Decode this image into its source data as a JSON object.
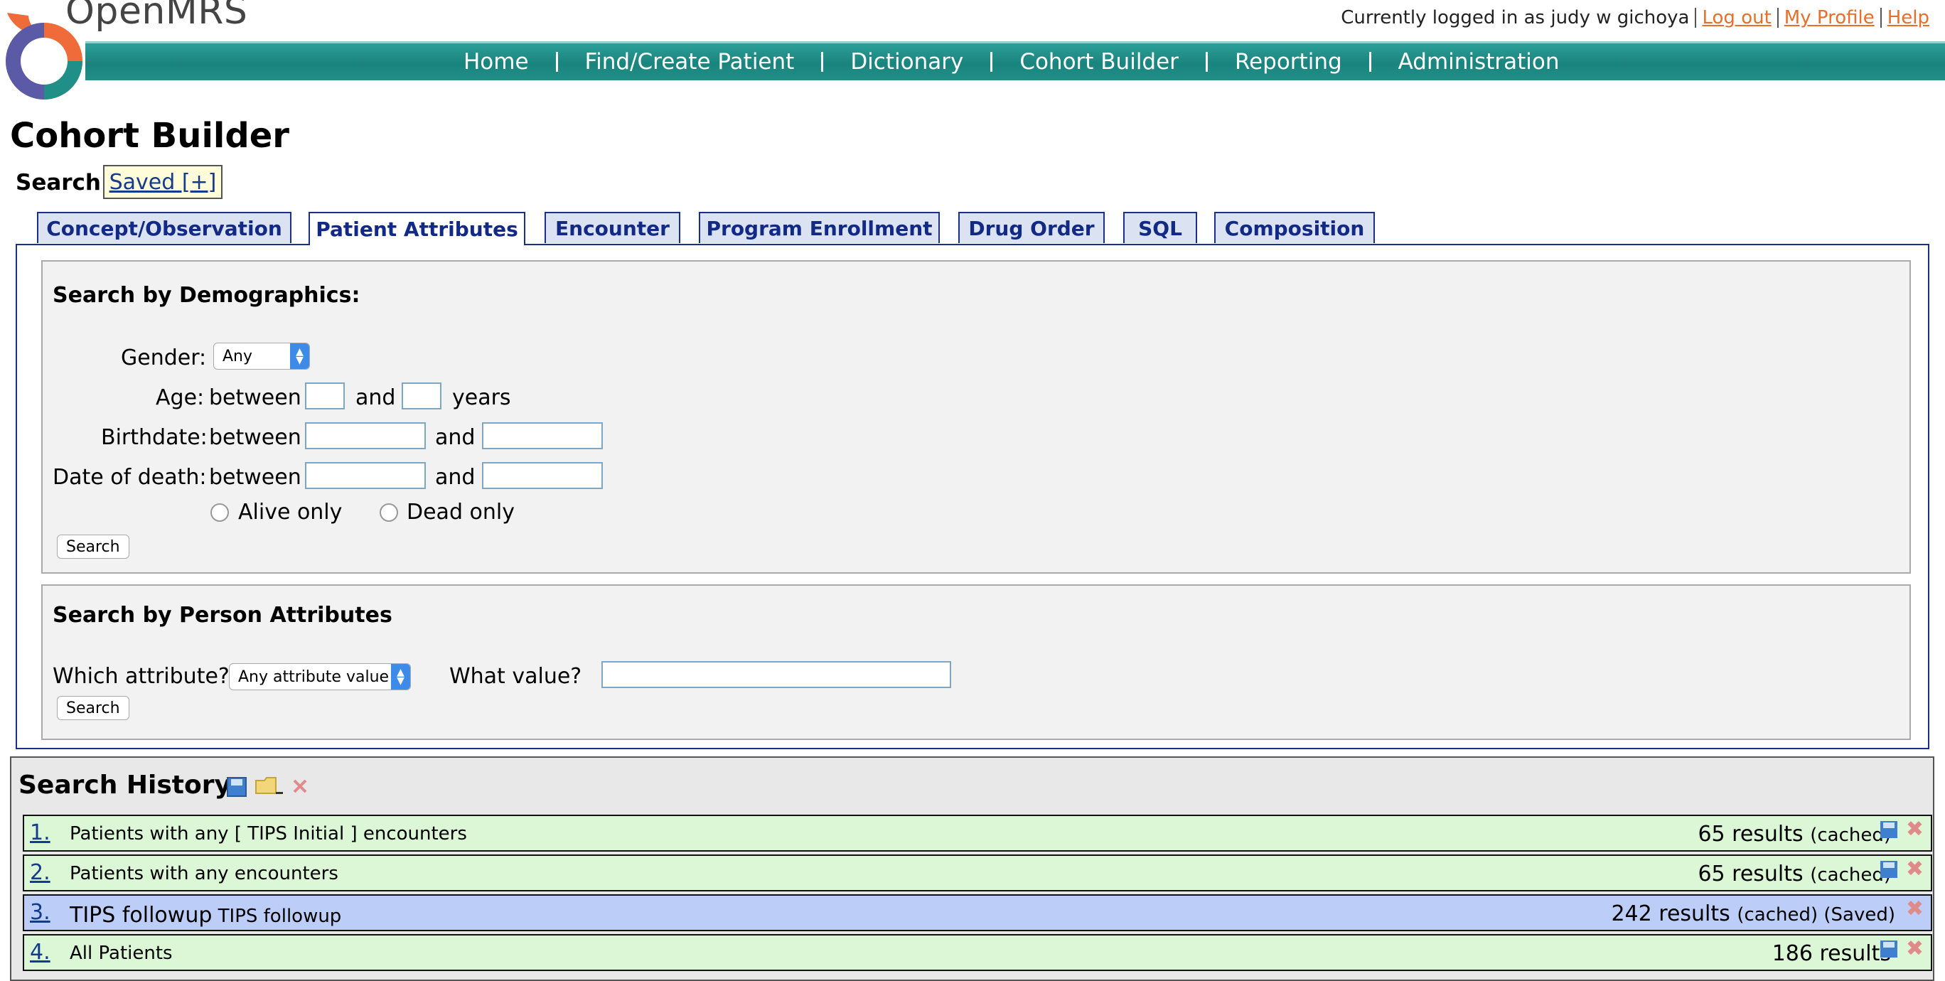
{
  "header": {
    "brand": "OpenMRS",
    "logged_in_text": "Currently logged in as judy w gichoya",
    "logout_label": "Log out",
    "profile_label": "My Profile",
    "help_label": "Help",
    "accent_color": "#e76f2a",
    "nav_color": "#1a847d"
  },
  "nav": {
    "items": [
      "Home",
      "Find/Create Patient",
      "Dictionary",
      "Cohort Builder",
      "Reporting",
      "Administration"
    ]
  },
  "page": {
    "title": "Cohort Builder",
    "view_search_label": "Search",
    "view_saved_label": "Saved [+]"
  },
  "tabs": {
    "items": [
      "Concept/Observation",
      "Patient Attributes",
      "Encounter",
      "Program Enrollment",
      "Drug Order",
      "SQL",
      "Composition"
    ],
    "active": "Patient Attributes"
  },
  "demographics": {
    "title": "Search by Demographics:",
    "gender_label": "Gender:",
    "gender_value": "Any",
    "age_label": "Age:",
    "birthdate_label": "Birthdate:",
    "death_label": "Date of death:",
    "between": "between",
    "and": "and",
    "years": "years",
    "alive_label": "Alive only",
    "dead_label": "Dead only",
    "search_button": "Search"
  },
  "person_attributes": {
    "title": "Search by Person Attributes",
    "which_label": "Which attribute?",
    "which_value": "Any attribute value",
    "what_label": "What value?",
    "search_button": "Search"
  },
  "history": {
    "title": "Search History",
    "rows": [
      {
        "num": "1.",
        "desc": "Patients with any [ TIPS Initial ] encounters",
        "count": "65 results",
        "status": "(cached)"
      },
      {
        "num": "2.",
        "desc": "Patients with any encounters",
        "count": "65 results",
        "status": "(cached)"
      },
      {
        "num": "3.",
        "name": "TIPS followup",
        "desc": "TIPS followup",
        "count": "242 results",
        "status": "(cached) (Saved)"
      },
      {
        "num": "4.",
        "desc": "All Patients",
        "count": "186 results",
        "status": ""
      }
    ]
  }
}
